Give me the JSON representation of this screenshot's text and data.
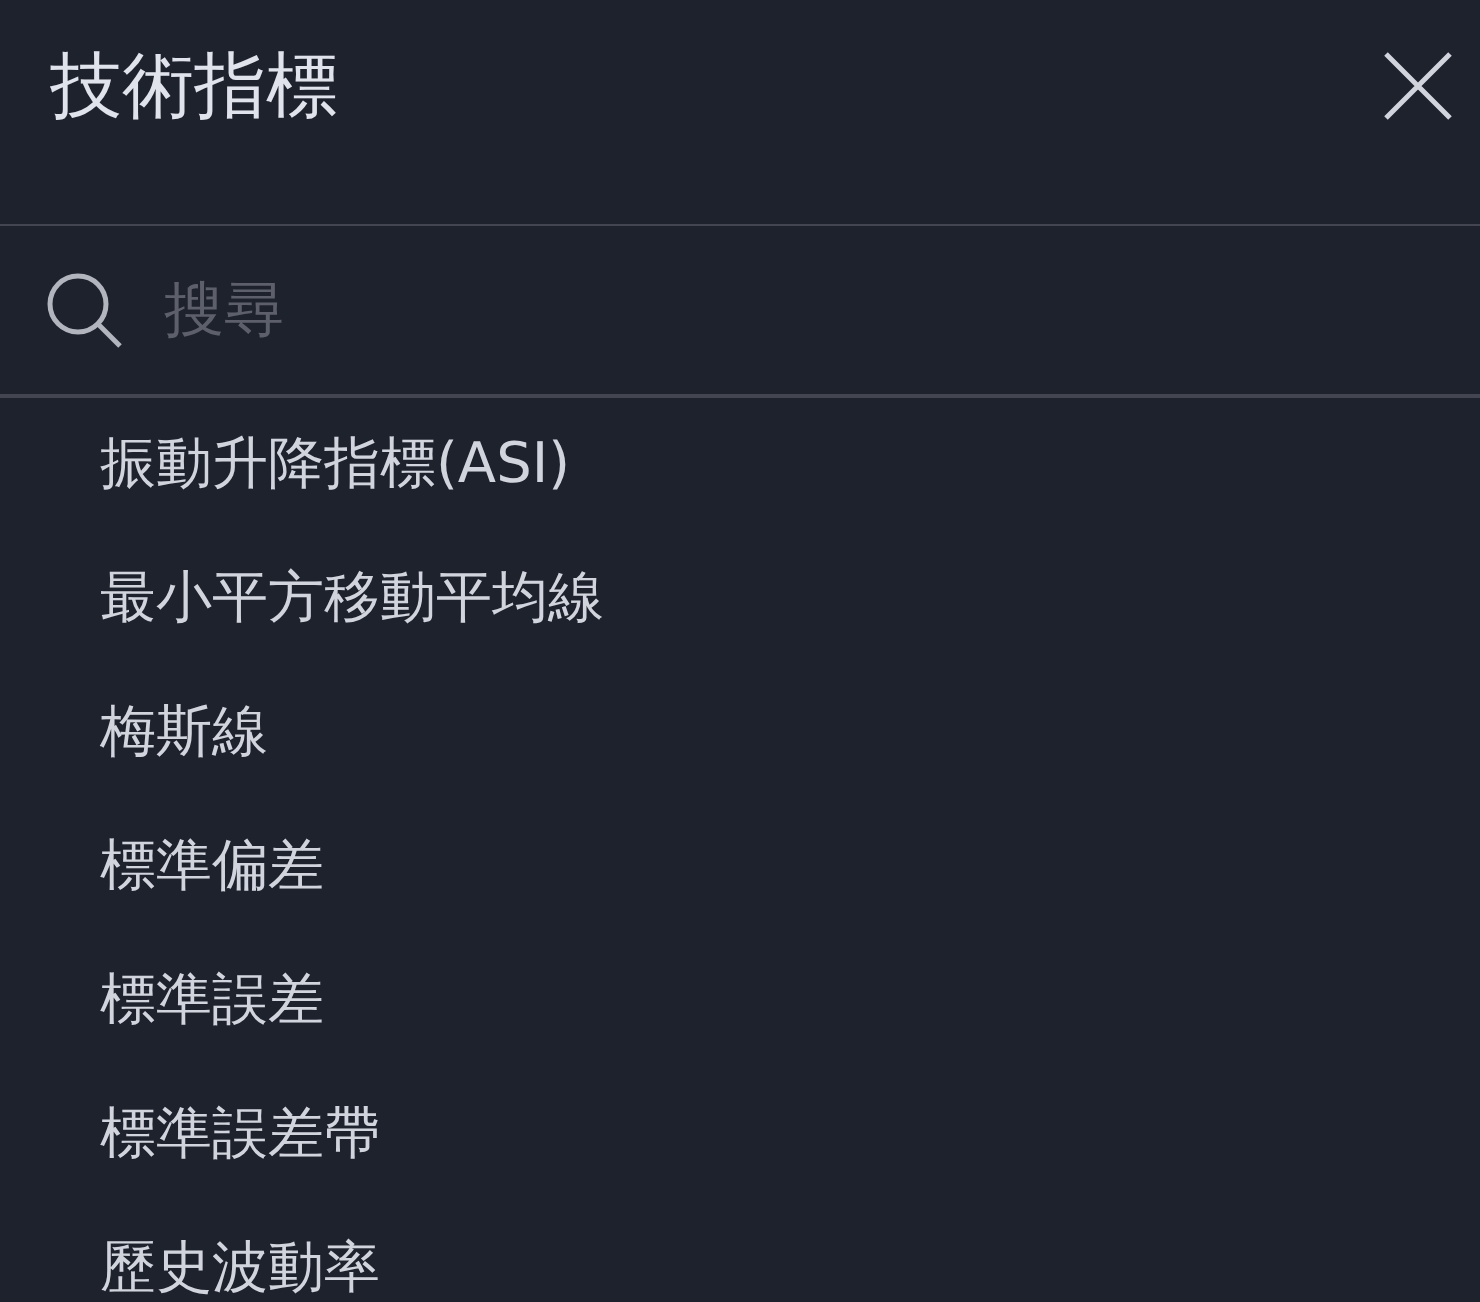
{
  "header": {
    "title": "技術指標"
  },
  "search": {
    "placeholder": "搜尋"
  },
  "indicators": [
    {
      "label": "振動升降指標(ASI)"
    },
    {
      "label": "最小平方移動平均線"
    },
    {
      "label": "梅斯線"
    },
    {
      "label": "標準偏差"
    },
    {
      "label": "標準誤差"
    },
    {
      "label": "標準誤差帶"
    },
    {
      "label": "歷史波動率"
    }
  ]
}
